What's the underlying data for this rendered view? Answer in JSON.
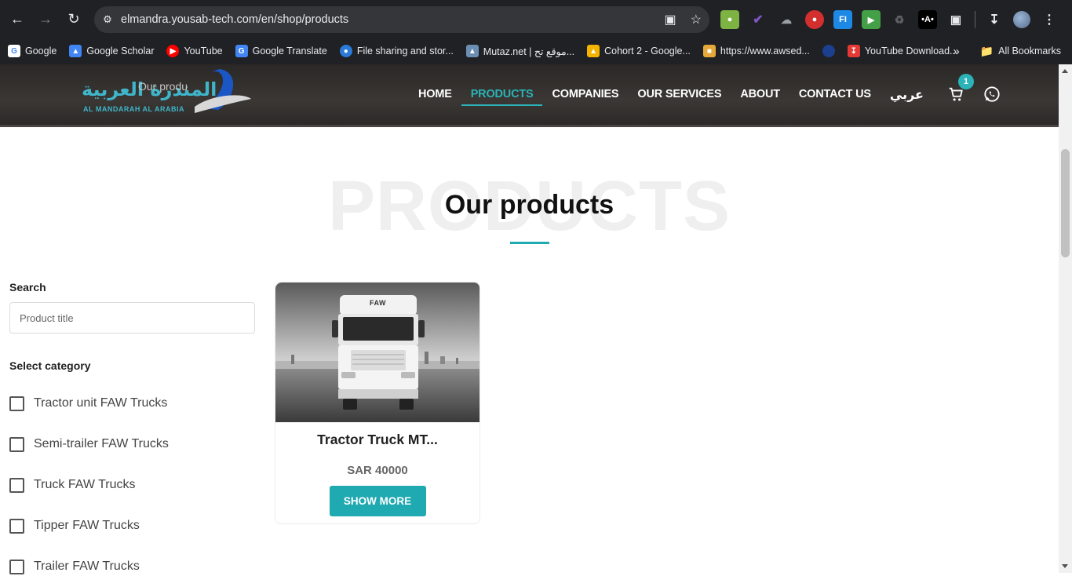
{
  "browser": {
    "url": "elmandra.yousab-tech.com/en/shop/products",
    "bookmarks": [
      {
        "label": "Google",
        "icon": "google-icon",
        "color": "#4285f4"
      },
      {
        "label": "Google Scholar",
        "icon": "scholar-icon",
        "color": "#4285f4"
      },
      {
        "label": "YouTube",
        "icon": "youtube-icon",
        "color": "#ff0000"
      },
      {
        "label": "Google Translate",
        "icon": "translate-icon",
        "color": "#4285f4"
      },
      {
        "label": "File sharing and stor...",
        "icon": "file-sharing-icon",
        "color": "#2a7ad8"
      },
      {
        "label": "Mutaz.net | موقع تح...",
        "icon": "mutaz-icon",
        "color": "#6a8fb3"
      },
      {
        "label": "Cohort 2 - Google...",
        "icon": "drive-icon",
        "color": "#f4b400"
      },
      {
        "label": "https://www.awsed...",
        "icon": "package-icon",
        "color": "#e5a93a"
      },
      {
        "label": "",
        "icon": "blue-circle-icon",
        "color": "#1c3f8f"
      },
      {
        "label": "YouTube Download...",
        "icon": "download-icon",
        "color": "#e53935"
      }
    ],
    "all_bookmarks": "All Bookmarks"
  },
  "site": {
    "logo_ar": "المندرة العربية",
    "logo_overlay": "Our produ",
    "logo_sub": "AL MANDARAH AL ARABIA",
    "nav": {
      "home": "HOME",
      "products": "PRODUCTS",
      "companies": "COMPANIES",
      "services": "OUR SERVICES",
      "about": "ABOUT",
      "contact": "CONTACT US",
      "lang": "عربي"
    },
    "cart_count": "1"
  },
  "page": {
    "title_bg": "PRODUCTS",
    "title": "Our products"
  },
  "sidebar": {
    "search_label": "Search",
    "search_placeholder": "Product title",
    "category_label": "Select category",
    "categories": [
      "Tractor unit FAW Trucks",
      "Semi-trailer FAW Trucks",
      "Truck FAW Trucks",
      "Tipper FAW Trucks",
      "Trailer FAW Trucks"
    ]
  },
  "products": [
    {
      "title": "Tractor Truck MT...",
      "price": "SAR 40000",
      "button": "SHOW MORE",
      "badge": "FAW"
    }
  ],
  "colors": {
    "accent": "#1fa9b0",
    "header_bg": "#2f2d2b"
  }
}
